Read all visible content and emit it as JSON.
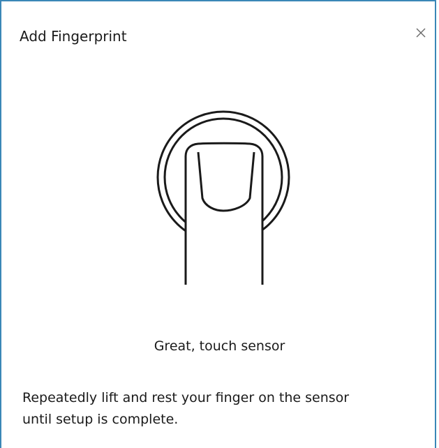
{
  "dialog": {
    "title": "Add Fingerprint",
    "close_icon": "close-icon",
    "illustration_icon": "finger-on-sensor-icon",
    "status_text": "Great, touch sensor",
    "instruction_line1": "Repeatedly lift and rest your finger on the sensor",
    "instruction_line2": "until setup is complete."
  },
  "colors": {
    "border_accent": "#3a87b7",
    "text": "#1a1a1a",
    "close_glyph": "#6b6b6b"
  }
}
